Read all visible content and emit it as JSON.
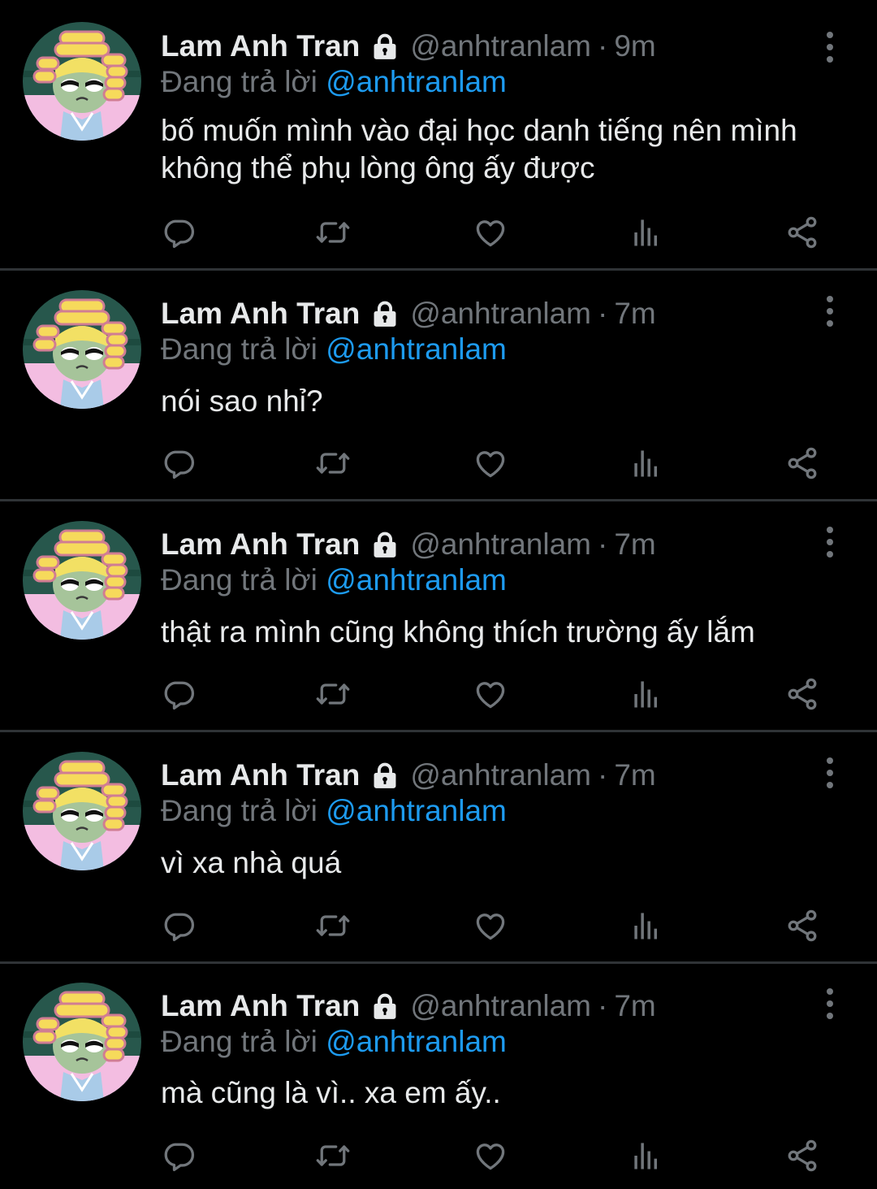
{
  "colors": {
    "background": "#000000",
    "text": "#e7e9ea",
    "muted": "#71767b",
    "accent": "#1d9bf0",
    "divider": "#2f3336"
  },
  "tweets": [
    {
      "name": "Lam Anh Tran",
      "handle": "@anhtranlam",
      "separator": "·",
      "time": "9m",
      "replying_prefix": "Đang trả lời",
      "replying_to": "@anhtranlam",
      "text": "bố muốn mình vào đại học danh tiếng nên mình không thể phụ lòng ông ấy được",
      "icons": [
        "avatar",
        "lock-icon",
        "more-vertical-icon",
        "reply-icon",
        "retweet-icon",
        "like-icon",
        "analytics-icon",
        "share-icon"
      ]
    },
    {
      "name": "Lam Anh Tran",
      "handle": "@anhtranlam",
      "separator": "·",
      "time": "7m",
      "replying_prefix": "Đang trả lời",
      "replying_to": "@anhtranlam",
      "text": "nói sao nhỉ?",
      "icons": [
        "avatar",
        "lock-icon",
        "more-vertical-icon",
        "reply-icon",
        "retweet-icon",
        "like-icon",
        "analytics-icon",
        "share-icon"
      ]
    },
    {
      "name": "Lam Anh Tran",
      "handle": "@anhtranlam",
      "separator": "·",
      "time": "7m",
      "replying_prefix": "Đang trả lời",
      "replying_to": "@anhtranlam",
      "text": "thật ra mình cũng không thích trường ấy lắm",
      "icons": [
        "avatar",
        "lock-icon",
        "more-vertical-icon",
        "reply-icon",
        "retweet-icon",
        "like-icon",
        "analytics-icon",
        "share-icon"
      ]
    },
    {
      "name": "Lam Anh Tran",
      "handle": "@anhtranlam",
      "separator": "·",
      "time": "7m",
      "replying_prefix": "Đang trả lời",
      "replying_to": "@anhtranlam",
      "text": "vì xa nhà quá",
      "icons": [
        "avatar",
        "lock-icon",
        "more-vertical-icon",
        "reply-icon",
        "retweet-icon",
        "like-icon",
        "analytics-icon",
        "share-icon"
      ]
    },
    {
      "name": "Lam Anh Tran",
      "handle": "@anhtranlam",
      "separator": "·",
      "time": "7m",
      "replying_prefix": "Đang trả lời",
      "replying_to": "@anhtranlam",
      "text": "mà cũng là vì.. xa em ấy..",
      "icons": [
        "avatar",
        "lock-icon",
        "more-vertical-icon",
        "reply-icon",
        "retweet-icon",
        "like-icon",
        "analytics-icon",
        "share-icon"
      ]
    }
  ]
}
